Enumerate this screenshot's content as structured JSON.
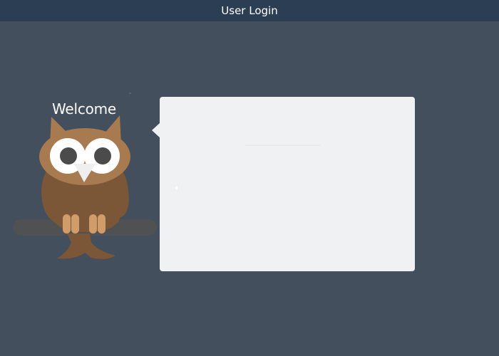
{
  "window": {
    "title": "User Login"
  },
  "owl": {
    "welcome_text": "Welcome"
  },
  "colors": {
    "background": "#434f5c",
    "titlebar": "#2c3e53",
    "panel": "#eff1f2",
    "owl_body": "#7b5737",
    "owl_face": "#a87a4f",
    "branch": "#4f5152"
  }
}
